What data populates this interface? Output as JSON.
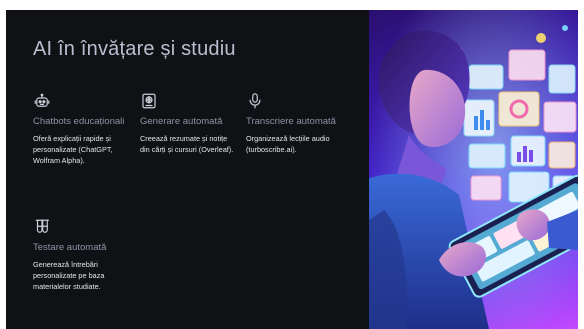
{
  "slide": {
    "title": "AI în învățare și studiu"
  },
  "features": [
    {
      "icon": "robot-icon",
      "title": "Chatbots educaționali",
      "description": "Oferă explicații rapide și personalizate (ChatGPT, Wolfram Alpha)."
    },
    {
      "icon": "document-icon",
      "title": "Generare automată",
      "description": "Creează rezumate și notițe din cărți și cursuri (Overleaf)."
    },
    {
      "icon": "microphone-icon",
      "title": "Transcriere automată",
      "description": "Organizează lecțiile audio (turboscribe.ai)."
    },
    {
      "icon": "test-tubes-icon",
      "title": "Testare automată",
      "description": "Generează întrebări personalizate pe baza materialelor studiate."
    }
  ],
  "colors": {
    "background": "#101115",
    "title": "#b9bfd0",
    "feature_title": "#8d93a3",
    "feature_text": "#e4e6ec",
    "accent_purple": "#4a2fe0"
  }
}
